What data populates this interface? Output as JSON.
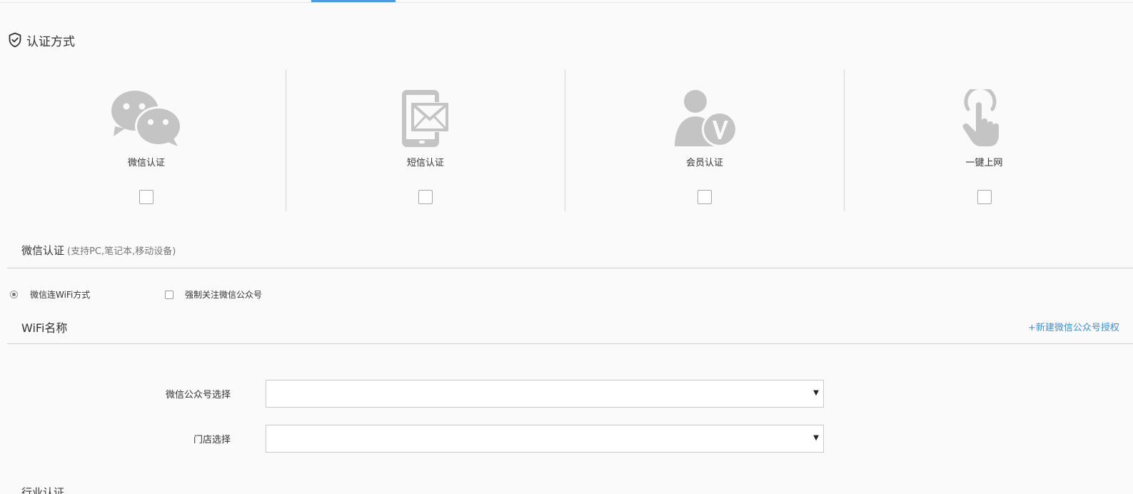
{
  "section": {
    "title": "认证方式",
    "icon": "shield-check-icon"
  },
  "methods": [
    {
      "label": "微信认证",
      "icon": "wechat-icon",
      "checked": false
    },
    {
      "label": "短信认证",
      "icon": "sms-phone-icon",
      "checked": false
    },
    {
      "label": "会员认证",
      "icon": "member-v-icon",
      "checked": false
    },
    {
      "label": "一键上网",
      "icon": "tap-hand-icon",
      "checked": false
    }
  ],
  "wechat_auth": {
    "title": "微信认证",
    "hint": "(支持PC,笔记本,移动设备)",
    "radio_label": "微信连WiFi方式",
    "checkbox_label": "强制关注微信公众号"
  },
  "wifi": {
    "title": "WiFi名称",
    "new_link": "+新建微信公众号授权"
  },
  "form": {
    "account_label": "微信公众号选择",
    "account_value": "",
    "store_label": "门店选择",
    "store_value": ""
  },
  "footer": {
    "cut_text": "行业认证"
  },
  "colors": {
    "accent": "#4a9be8",
    "link": "#3d8fe0",
    "icon_gray": "#c4c4c4"
  }
}
